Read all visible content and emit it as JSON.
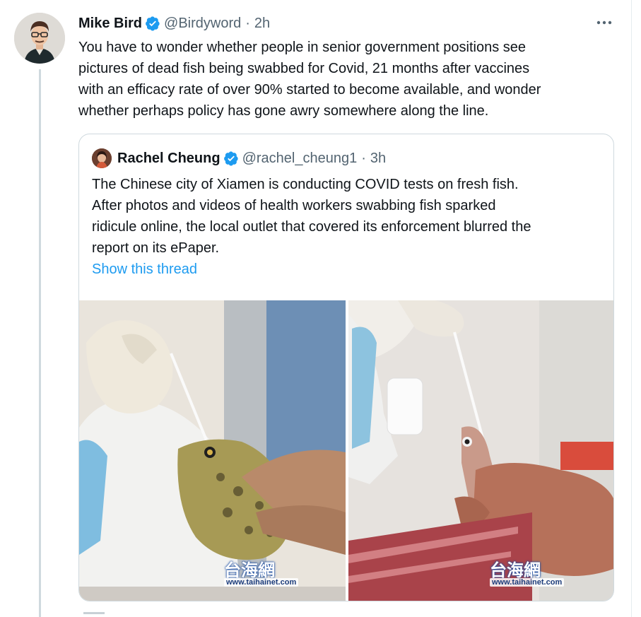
{
  "tweet": {
    "author_name": "Mike Bird",
    "author_handle": "@Birdyword",
    "separator": "·",
    "time": "2h",
    "more_icon": "more-horizontal-icon",
    "text_lines": [
      "You have to wonder whether people in senior government positions see",
      "pictures of dead fish being swabbed for Covid, 21 months after vaccines",
      "with an efficacy rate of over 90% started to become available, and wonder",
      "whether perhaps policy has gone awry somewhere along the line."
    ]
  },
  "quote": {
    "author_name": "Rachel Cheung",
    "author_handle": "@rachel_cheung1",
    "separator": "·",
    "time": "3h",
    "text_lines": [
      "The Chinese city of Xiamen is conducting COVID tests on fresh fish.",
      "After photos and videos of health workers swabbing fish sparked",
      "ridicule online, the local outlet that covered its enforcement blurred the",
      "report on its ePaper."
    ],
    "show_thread": "Show this thread",
    "media": [
      {
        "watermark": "台海網",
        "watermark_url": "www.taihainet.com"
      },
      {
        "watermark": "台海網",
        "watermark_url": "www.taihainet.com"
      }
    ]
  },
  "colors": {
    "verified": "#1d9bf0",
    "link": "#1d9bf0",
    "secondary_text": "#536471",
    "border": "#cfd9de"
  }
}
